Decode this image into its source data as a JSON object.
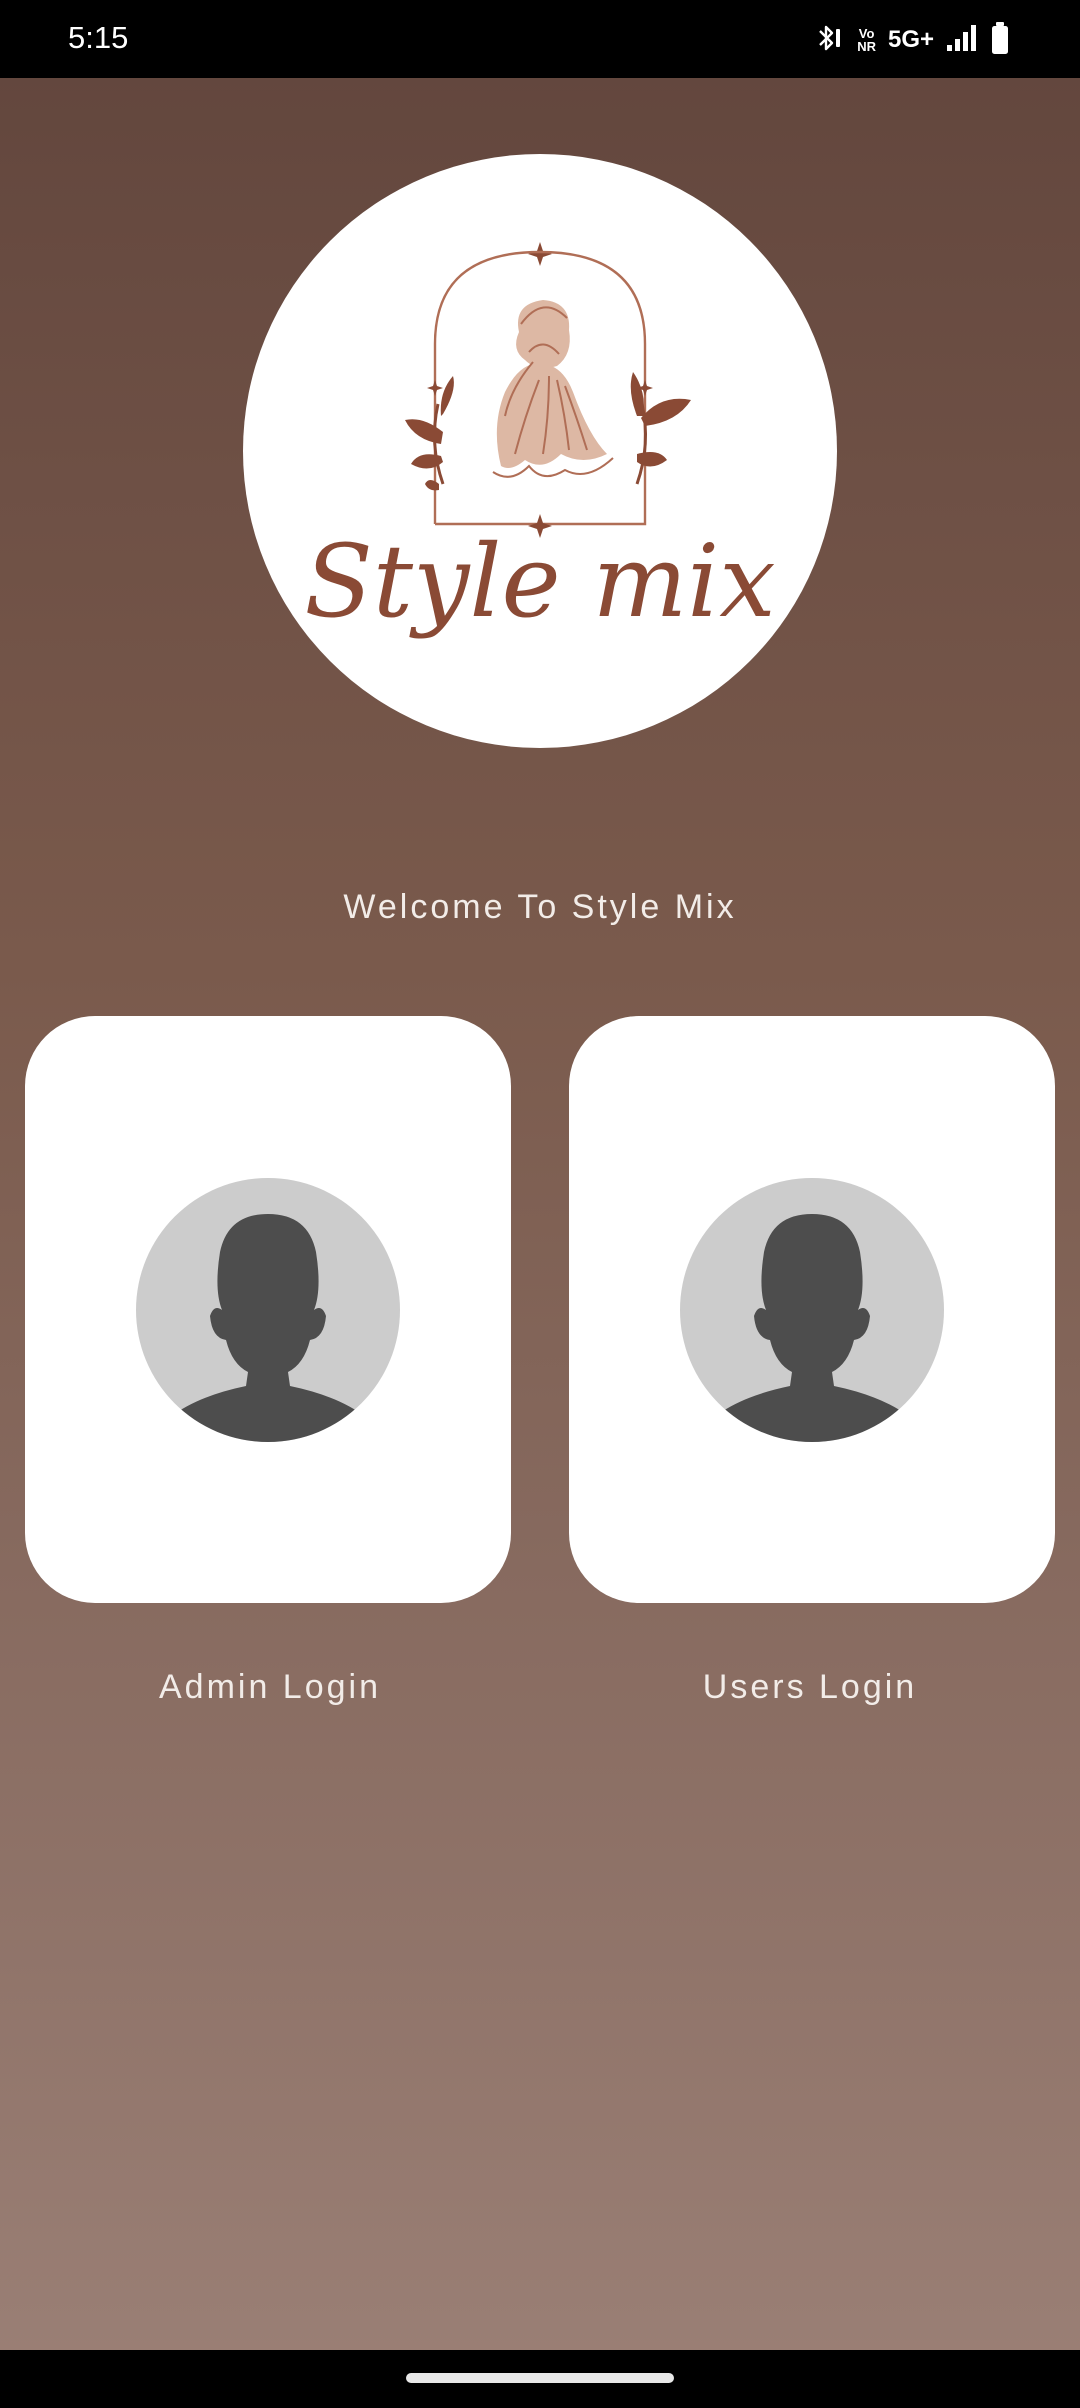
{
  "status_bar": {
    "time": "5:15",
    "network": "5G+",
    "volte_top": "Vo",
    "volte_bottom": "NR",
    "icons": [
      "bluetooth-icon",
      "volte-icon",
      "signal-icon",
      "battery-icon"
    ]
  },
  "logo": {
    "brand_text": "Style mix",
    "accent_color": "#8a4a35",
    "light_color": "#ddb8a4"
  },
  "welcome_text": "Welcome To Style Mix",
  "login_options": [
    {
      "id": "admin",
      "label": "Admin Login",
      "icon": "avatar-placeholder-icon"
    },
    {
      "id": "users",
      "label": "Users Login",
      "icon": "avatar-placeholder-icon"
    }
  ],
  "colors": {
    "background_top": "#61453c",
    "background_bottom": "#9b8076",
    "card": "#ffffff",
    "avatar_bg": "#cccccc",
    "avatar_silhouette": "#4d4d4d"
  }
}
